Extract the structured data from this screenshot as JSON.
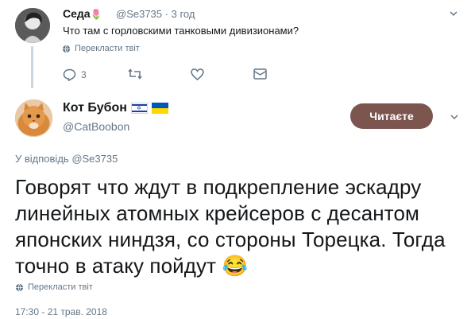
{
  "reply_tweet": {
    "display_name": "Седа",
    "handle": "@Se3735",
    "time_ago": "3 год",
    "text": "Что там с горловскими танковыми дивизионами?",
    "translate_label": "Перекласти твіт",
    "actions": {
      "reply_count": "3",
      "retweet_count": "",
      "like_count": ""
    },
    "icons": [
      "reply-icon",
      "retweet-icon",
      "like-icon",
      "message-icon",
      "chevron-down-icon"
    ]
  },
  "main_tweet": {
    "display_name": "Кот Бубон",
    "handle": "@CatBoobon",
    "follow_button_label": "Читаєте",
    "replying_to_prefix": "У відповідь",
    "replying_to_handle": "@Se3735",
    "text": "Говорят что ждут в подкрепление эскадру линейных атомных крейсеров с десантом японских ниндзя, со стороны Торецка. Тогда точно в атаку пойдут",
    "emoji": "😂",
    "translate_label": "Перекласти твіт",
    "timestamp": "17:30 - 21 трав. 2018",
    "flags": [
      "israel-flag",
      "ukraine-flag"
    ]
  },
  "colors": {
    "follow_button_bg": "#7d554f",
    "muted_text": "#657786",
    "thread_line": "#ccd6dd",
    "ukraine_blue": "#0057b7",
    "ukraine_yellow": "#ffd700",
    "israel_blue": "#1b3fa8"
  }
}
